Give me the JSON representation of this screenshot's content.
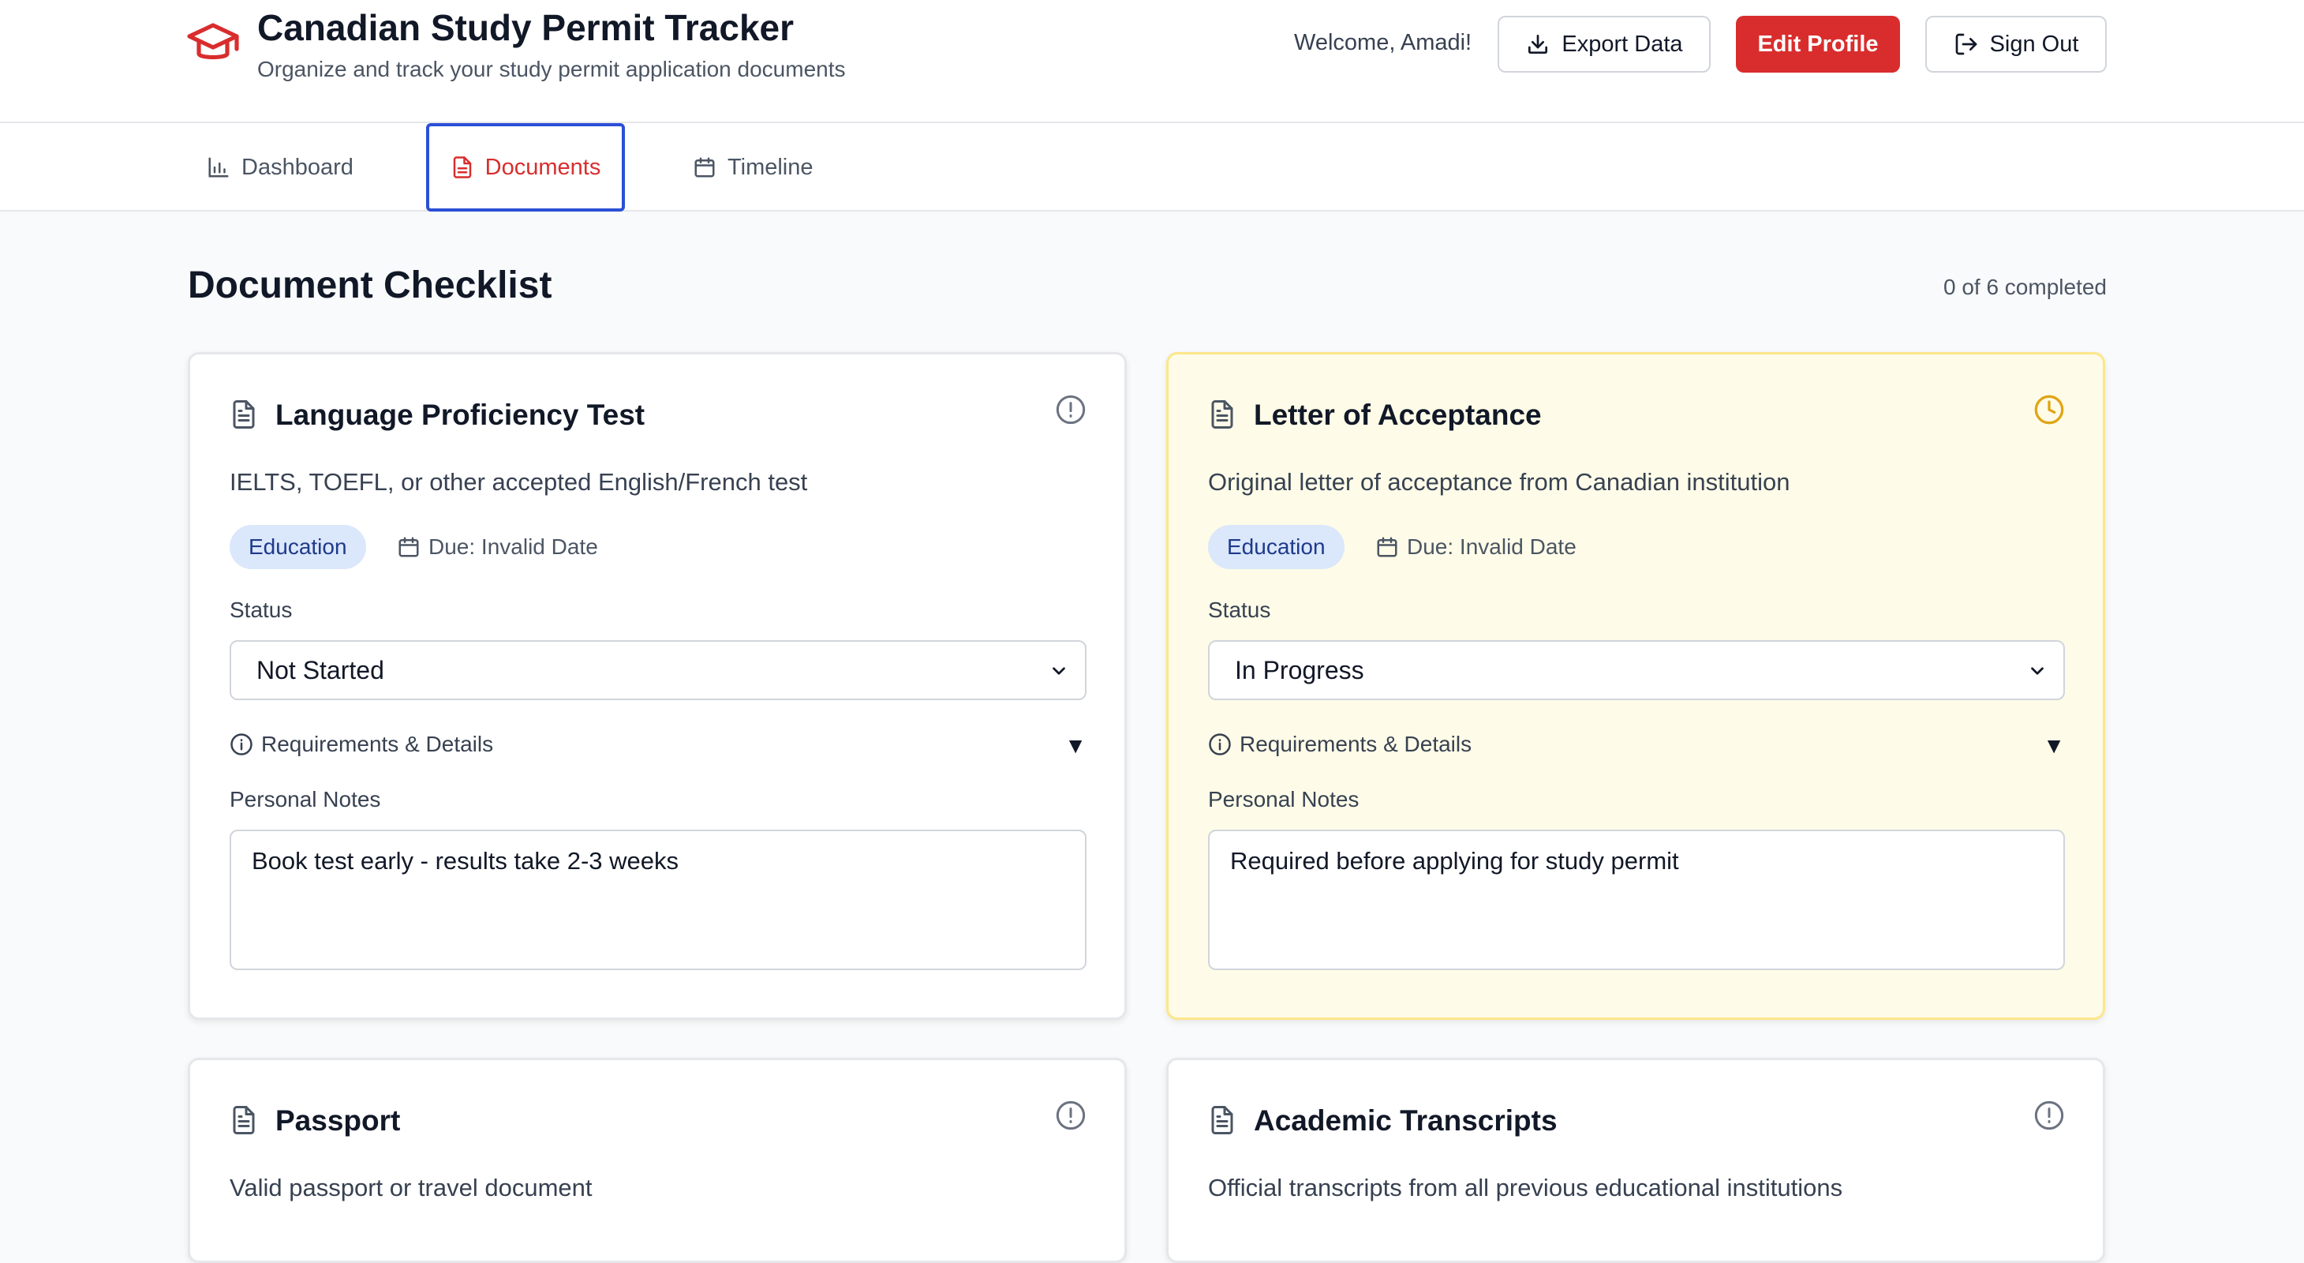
{
  "header": {
    "title": "Canadian Study Permit Tracker",
    "subtitle": "Organize and track your study permit application documents",
    "welcome": "Welcome, Amadi!",
    "export_label": "Export Data",
    "edit_label": "Edit Profile",
    "signout_label": "Sign Out",
    "logo_icon": "graduation-cap-icon",
    "accent_color": "#d92d2d"
  },
  "tabs": [
    {
      "label": "Dashboard",
      "icon": "bar-chart-icon",
      "active": false
    },
    {
      "label": "Documents",
      "icon": "file-icon",
      "active": true
    },
    {
      "label": "Timeline",
      "icon": "calendar-icon",
      "active": false
    }
  ],
  "checklist": {
    "title": "Document Checklist",
    "completed_text": "0 of 6 completed",
    "status_label": "Status",
    "requirements_label": "Requirements & Details",
    "notes_label": "Personal Notes",
    "cards": [
      {
        "title": "Language Proficiency Test",
        "description": "IELTS, TOEFL, or other accepted English/French test",
        "category": "Education",
        "due": "Due: Invalid Date",
        "status": "Not Started",
        "status_icon": "alert-circle-icon",
        "notes": "Book test early - results take 2-3 weeks"
      },
      {
        "title": "Letter of Acceptance",
        "description": "Original letter of acceptance from Canadian institution",
        "category": "Education",
        "due": "Due: Invalid Date",
        "status": "In Progress",
        "status_icon": "clock-icon",
        "notes": "Required before applying for study permit"
      },
      {
        "title": "Passport",
        "description": "Valid passport or travel document",
        "status_icon": "alert-circle-icon"
      },
      {
        "title": "Academic Transcripts",
        "description": "Official transcripts from all previous educational institutions",
        "status_icon": "alert-circle-icon"
      }
    ]
  }
}
